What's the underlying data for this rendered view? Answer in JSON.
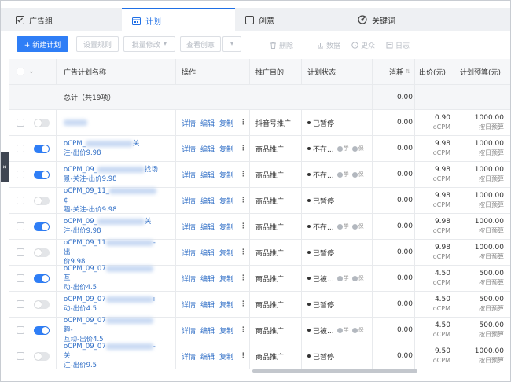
{
  "tabs": [
    {
      "label": "广告组",
      "icon": "checkbox-icon"
    },
    {
      "label": "计划",
      "icon": "calendar-icon",
      "active": true
    },
    {
      "label": "创意",
      "icon": "creative-icon"
    },
    {
      "label": "关键词",
      "icon": "target-icon"
    }
  ],
  "toolbar": {
    "new_plan": "+ 新建计划",
    "setup_rules": "设置规则",
    "batch_edit": "批量修改",
    "view_creative": "查看创意",
    "delete": "删除",
    "data": "数据",
    "history": "史众",
    "log": "日志"
  },
  "columns": {
    "name": "广告计划名称",
    "ops": "操作",
    "goal": "推广目的",
    "status": "计划状态",
    "consume": "消耗",
    "bid": "出价(元)",
    "budget": "计划预算(元)"
  },
  "summary": {
    "label": "总计（共19项）",
    "consume": "0.00"
  },
  "op_labels": {
    "detail": "详情",
    "edit": "编辑",
    "copy": "复制",
    "more": "⋮"
  },
  "chip_labels": {
    "learn": "学",
    "guard": "保"
  },
  "rows": [
    {
      "on": false,
      "name_pre": "",
      "name_post": "",
      "goal": "抖音号推广",
      "status": "已暂停",
      "chips": false,
      "consume": "0.00",
      "bid": "0.90",
      "bid_type": "oCPM",
      "budget": "1000.00",
      "budget_type": "按日预算"
    },
    {
      "on": true,
      "name_pre": "oCPM_",
      "name_post": "关\n注-出价9.98",
      "goal": "商品推广",
      "status": "不在...",
      "chips": true,
      "consume": "0.00",
      "bid": "9.98",
      "bid_type": "oCPM",
      "budget": "1000.00",
      "budget_type": "按日预算"
    },
    {
      "on": true,
      "name_pre": "oCPM_09_",
      "name_post": "找场\n景-关注-出价9.98",
      "goal": "商品推广",
      "status": "不在...",
      "chips": true,
      "consume": "0.00",
      "bid": "9.98",
      "bid_type": "oCPM",
      "budget": "1000.00",
      "budget_type": "按日预算"
    },
    {
      "on": false,
      "name_pre": "oCPM_09_11_",
      "name_post": "¢\n趣-关注-出价9.98",
      "goal": "商品推广",
      "status": "已暂停",
      "chips": false,
      "consume": "0.00",
      "bid": "9.98",
      "bid_type": "oCPM",
      "budget": "1000.00",
      "budget_type": "按日预算"
    },
    {
      "on": true,
      "name_pre": "oCPM_09_",
      "name_post": "关\n注-出价9.98",
      "goal": "商品推广",
      "status": "不在...",
      "chips": true,
      "consume": "0.00",
      "bid": "9.98",
      "bid_type": "oCPM",
      "budget": "1000.00",
      "budget_type": "按日预算"
    },
    {
      "on": false,
      "name_pre": "oCPM_09_11",
      "name_post": "-出\n价9.98",
      "goal": "商品推广",
      "status": "已暂停",
      "chips": false,
      "consume": "0.00",
      "bid": "9.98",
      "bid_type": "oCPM",
      "budget": "1000.00",
      "budget_type": "按日预算"
    },
    {
      "on": true,
      "name_pre": "oCPM_09_07",
      "name_post": "互\n动-出价4.5",
      "goal": "商品推广",
      "status": "已被...",
      "chips": true,
      "consume": "0.00",
      "bid": "4.50",
      "bid_type": "oCPM",
      "budget": "500.00",
      "budget_type": "按日预算"
    },
    {
      "on": false,
      "name_pre": "oCPM_09_07",
      "name_post": "i\n动-出价4.5",
      "goal": "商品推广",
      "status": "已暂停",
      "chips": false,
      "consume": "0.00",
      "bid": "4.50",
      "bid_type": "oCPM",
      "budget": "500.00",
      "budget_type": "按日预算"
    },
    {
      "on": true,
      "name_pre": "oCPM_09_07",
      "name_post": "趣-\n互动-出价4.5",
      "goal": "商品推广",
      "status": "已被...",
      "chips": true,
      "consume": "0.00",
      "bid": "4.50",
      "bid_type": "oCPM",
      "budget": "500.00",
      "budget_type": "按日预算"
    },
    {
      "on": false,
      "name_pre": "oCPM_09_07",
      "name_post": "-关\n注-出价9.5",
      "goal": "商品推广",
      "status": "已暂停",
      "chips": false,
      "consume": "0.00",
      "bid": "9.50",
      "bid_type": "oCPM",
      "budget": "1000.00",
      "budget_type": "按日预算"
    }
  ],
  "side_handle": "»"
}
